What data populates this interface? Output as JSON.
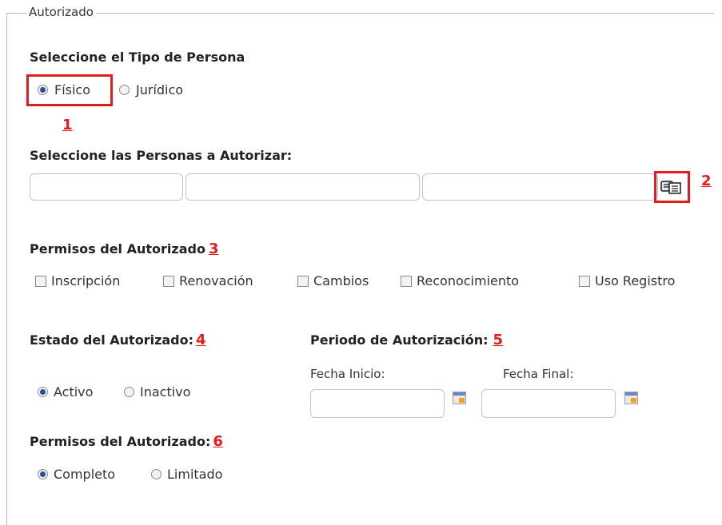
{
  "fieldset": {
    "legend": "Autorizado"
  },
  "tipo_persona": {
    "heading": "Seleccione el Tipo de Persona",
    "options": [
      {
        "label": "Físico",
        "selected": true
      },
      {
        "label": "Jurídico",
        "selected": false
      }
    ],
    "marker": "1"
  },
  "personas": {
    "heading": "Seleccione las Personas a Autorizar:",
    "fields": [
      "",
      "",
      ""
    ],
    "search_icon": "lookup-card-icon",
    "marker": "2"
  },
  "permisos": {
    "heading": "Permisos del Autorizado",
    "marker": "3",
    "checkboxes": [
      "Inscripción",
      "Renovación",
      "Cambios",
      "Reconocimiento",
      "Uso Registro"
    ]
  },
  "estado": {
    "heading": "Estado del Autorizado:",
    "marker": "4",
    "options": [
      {
        "label": "Activo",
        "selected": true
      },
      {
        "label": "Inactivo",
        "selected": false
      }
    ]
  },
  "periodo": {
    "heading": "Periodo de Autorización:",
    "marker": "5",
    "inicio_label": "Fecha Inicio:",
    "final_label": "Fecha Final:",
    "inicio_value": "",
    "final_value": ""
  },
  "permisos_tipo": {
    "heading": "Permisos del Autorizado:",
    "marker": "6",
    "options": [
      {
        "label": "Completo",
        "selected": true
      },
      {
        "label": "Limitado",
        "selected": false
      }
    ]
  },
  "colors": {
    "annotation_red": "#e01e1e",
    "radio_fill": "#2a4f9a"
  }
}
